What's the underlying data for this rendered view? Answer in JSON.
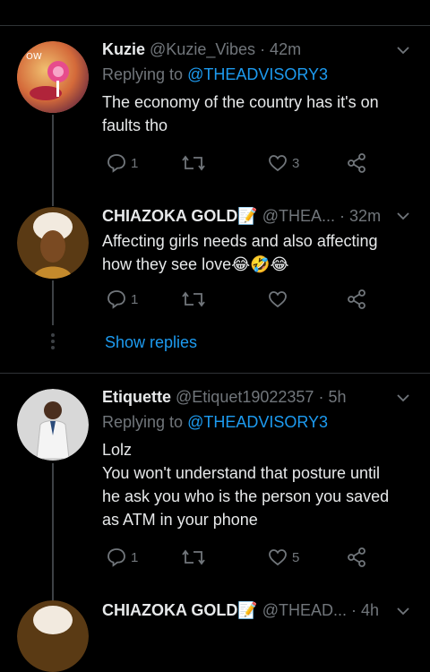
{
  "tweets": [
    {
      "name": "Kuzie",
      "handle": "@Kuzie_Vibes",
      "time": "· 42m",
      "replying_label": "Replying to",
      "replying_to": "@THEADVISORY3",
      "text_lines": [
        "The economy of the country has it's on",
        "faults tho"
      ],
      "reply_count": "1",
      "retweet_count": "",
      "like_count": "3"
    },
    {
      "name": "CHIAZOKA GOLD📝",
      "handle": "@THEA...",
      "time": "· 32m",
      "text_lines": [
        "Affecting girls needs and also affecting",
        "how they see love😂🤣😂"
      ],
      "reply_count": "1",
      "retweet_count": "",
      "like_count": ""
    },
    {
      "name": "Etiquette",
      "handle": "@Etiquet19022357",
      "time": "· 5h",
      "replying_label": "Replying to",
      "replying_to": "@THEADVISORY3",
      "text_lines": [
        "Lolz",
        "You won't understand that posture until",
        "he ask you who is the person you saved",
        "as ATM in your phone"
      ],
      "reply_count": "1",
      "retweet_count": "",
      "like_count": "5"
    },
    {
      "name": "CHIAZOKA GOLD📝",
      "handle": "@THEAD...",
      "time": "· 4h"
    }
  ],
  "show_replies": "Show replies",
  "colors": {
    "accent": "#1d9bf0",
    "muted": "#71767b",
    "text": "#e7e9ea",
    "bg": "#000000"
  },
  "icons": [
    "reply-icon",
    "retweet-icon",
    "like-icon",
    "share-icon",
    "chevron-down-icon"
  ]
}
